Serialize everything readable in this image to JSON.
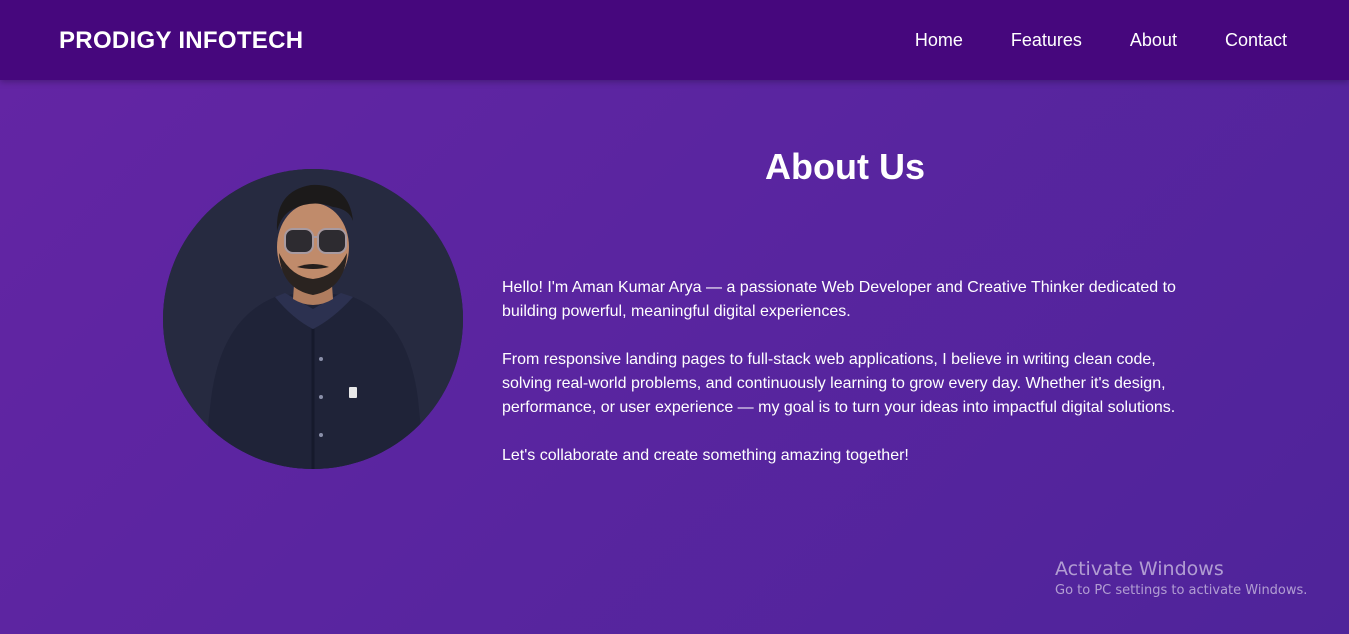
{
  "brand": "PRODIGY INFOTECH",
  "nav": {
    "items": [
      "Home",
      "Features",
      "About",
      "Contact"
    ]
  },
  "about": {
    "title": "About Us",
    "paragraphs": [
      "Hello! I'm Aman Kumar Arya — a passionate Web Developer and Creative Thinker dedicated to building powerful, meaningful digital experiences.",
      "From responsive landing pages to full-stack web applications, I believe in writing clean code, solving real-world problems, and continuously learning to grow every day. Whether it's design, performance, or user experience — my goal is to turn your ideas into impactful digital solutions.",
      "Let's collaborate and create something amazing together!"
    ]
  },
  "watermark": {
    "title": "Activate Windows",
    "subtitle": "Go to PC settings to activate Windows."
  },
  "colors": {
    "navbar": "#46077d",
    "background": "#5a25a0",
    "text": "#ffffff"
  }
}
